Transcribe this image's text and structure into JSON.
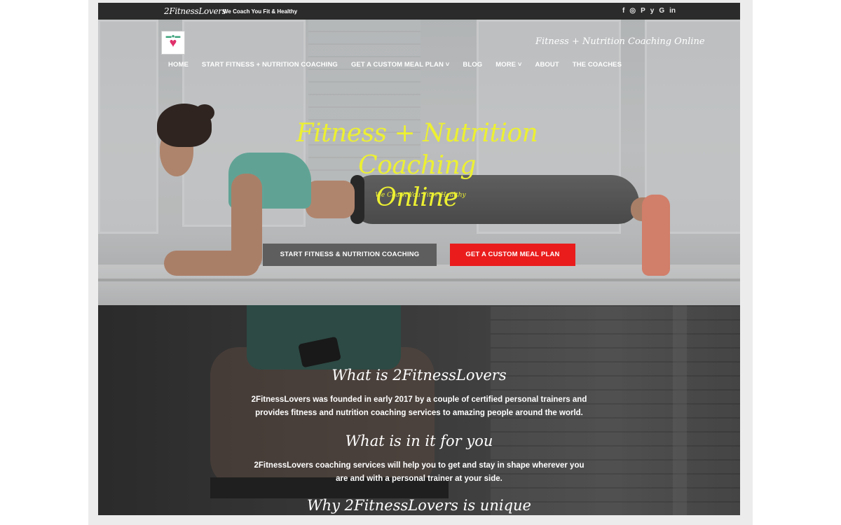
{
  "topbar": {
    "brand": "2FitnessLovers",
    "slogan": "We Coach You Fit & Healthy",
    "social": [
      "f",
      "◎",
      "P",
      "y",
      "G",
      "in"
    ]
  },
  "header": {
    "tagline": "Fitness + Nutrition Coaching Online",
    "nav": [
      "HOME",
      "START FITNESS + NUTRITION COACHING",
      "GET A CUSTOM MEAL PLAN ˅",
      "BLOG",
      "MORE ˅",
      "ABOUT",
      "THE COACHES"
    ]
  },
  "hero": {
    "title_line1": "Fitness + Nutrition Coaching",
    "title_line2": "Online",
    "subtitle": "We Coach You Fit + Healthy",
    "btn_primary": "START FITNESS & NUTRITION COACHING",
    "btn_secondary": "GET A CUSTOM MEAL PLAN"
  },
  "about": {
    "h1": "What is 2FitnessLovers",
    "p1_line1": "2FitnessLovers was founded in early 2017 by a couple of certified personal trainers and",
    "p1_line2": "provides fitness and nutrition coaching services to amazing people around the world.",
    "h2": "What is in it for you",
    "p2_line1": "2FitnessLovers coaching services will help you to get and stay in shape wherever you",
    "p2_line2": "are and with a personal trainer at your side.",
    "h3": "Why 2FitnessLovers is unique"
  },
  "colors": {
    "accent_yellow": "#ecf032",
    "cta_red": "#ea1c1c",
    "cta_grey": "#5e5e5e",
    "topbar": "#2b2b2b"
  }
}
